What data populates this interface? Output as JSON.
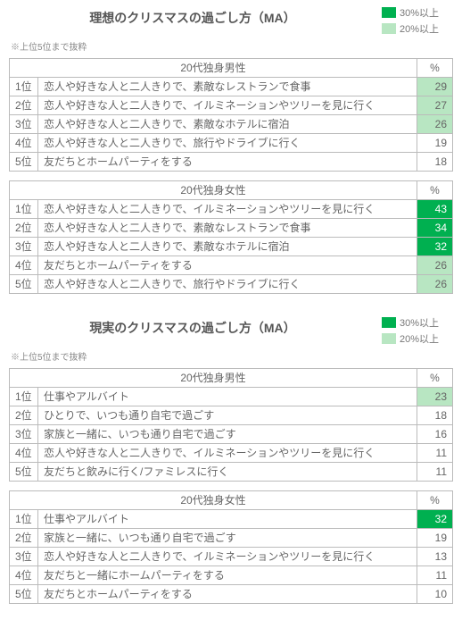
{
  "legend": {
    "high": "30%以上",
    "mid": "20%以上"
  },
  "note": "※上位5位まで抜粋",
  "col_pct": "%",
  "sections": [
    {
      "title": "理想のクリスマスの過ごし方（MA）",
      "tables": [
        {
          "header": "20代独身男性",
          "rows": [
            {
              "rank": "1位",
              "item": "恋人や好きな人と二人きりで、素敵なレストランで食事",
              "pct": 29,
              "shade": "light"
            },
            {
              "rank": "2位",
              "item": "恋人や好きな人と二人きりで、イルミネーションやツリーを見に行く",
              "pct": 27,
              "shade": "light"
            },
            {
              "rank": "3位",
              "item": "恋人や好きな人と二人きりで、素敵なホテルに宿泊",
              "pct": 26,
              "shade": "light"
            },
            {
              "rank": "4位",
              "item": "恋人や好きな人と二人きりで、旅行やドライブに行く",
              "pct": 19,
              "shade": ""
            },
            {
              "rank": "5位",
              "item": "友だちとホームパーティをする",
              "pct": 18,
              "shade": ""
            }
          ]
        },
        {
          "header": "20代独身女性",
          "rows": [
            {
              "rank": "1位",
              "item": "恋人や好きな人と二人きりで、イルミネーションやツリーを見に行く",
              "pct": 43,
              "shade": "dark"
            },
            {
              "rank": "2位",
              "item": "恋人や好きな人と二人きりで、素敵なレストランで食事",
              "pct": 34,
              "shade": "dark"
            },
            {
              "rank": "3位",
              "item": "恋人や好きな人と二人きりで、素敵なホテルに宿泊",
              "pct": 32,
              "shade": "dark"
            },
            {
              "rank": "4位",
              "item": "友だちとホームパーティをする",
              "pct": 26,
              "shade": "light"
            },
            {
              "rank": "5位",
              "item": "恋人や好きな人と二人きりで、旅行やドライブに行く",
              "pct": 26,
              "shade": "light"
            }
          ]
        }
      ]
    },
    {
      "title": "現実のクリスマスの過ごし方（MA）",
      "tables": [
        {
          "header": "20代独身男性",
          "rows": [
            {
              "rank": "1位",
              "item": "仕事やアルバイト",
              "pct": 23,
              "shade": "light"
            },
            {
              "rank": "2位",
              "item": "ひとりで、いつも通り自宅で過ごす",
              "pct": 18,
              "shade": ""
            },
            {
              "rank": "3位",
              "item": "家族と一緒に、いつも通り自宅で過ごす",
              "pct": 16,
              "shade": ""
            },
            {
              "rank": "4位",
              "item": "恋人や好きな人と二人きりで、イルミネーションやツリーを見に行く",
              "pct": 11,
              "shade": ""
            },
            {
              "rank": "5位",
              "item": "友だちと飲みに行く/ファミレスに行く",
              "pct": 11,
              "shade": ""
            }
          ]
        },
        {
          "header": "20代独身女性",
          "rows": [
            {
              "rank": "1位",
              "item": "仕事やアルバイト",
              "pct": 32,
              "shade": "dark"
            },
            {
              "rank": "2位",
              "item": "家族と一緒に、いつも通り自宅で過ごす",
              "pct": 19,
              "shade": ""
            },
            {
              "rank": "3位",
              "item": "恋人や好きな人と二人きりで、イルミネーションやツリーを見に行く",
              "pct": 13,
              "shade": ""
            },
            {
              "rank": "4位",
              "item": "友だちと一緒にホームパーティをする",
              "pct": 11,
              "shade": ""
            },
            {
              "rank": "5位",
              "item": "友だちとホームパーティをする",
              "pct": 10,
              "shade": ""
            }
          ]
        }
      ]
    }
  ],
  "chart_data": [
    {
      "type": "table",
      "title": "理想のクリスマスの過ごし方（MA） 20代独身男性",
      "categories": [
        "恋人や好きな人と二人きりで、素敵なレストランで食事",
        "恋人や好きな人と二人きりで、イルミネーションやツリーを見に行く",
        "恋人や好きな人と二人きりで、素敵なホテルに宿泊",
        "恋人や好きな人と二人きりで、旅行やドライブに行く",
        "友だちとホームパーティをする"
      ],
      "values": [
        29,
        27,
        26,
        19,
        18
      ],
      "ylabel": "%",
      "ylim": [
        0,
        100
      ]
    },
    {
      "type": "table",
      "title": "理想のクリスマスの過ごし方（MA） 20代独身女性",
      "categories": [
        "恋人や好きな人と二人きりで、イルミネーションやツリーを見に行く",
        "恋人や好きな人と二人きりで、素敵なレストランで食事",
        "恋人や好きな人と二人きりで、素敵なホテルに宿泊",
        "友だちとホームパーティをする",
        "恋人や好きな人と二人きりで、旅行やドライブに行く"
      ],
      "values": [
        43,
        34,
        32,
        26,
        26
      ],
      "ylabel": "%",
      "ylim": [
        0,
        100
      ]
    },
    {
      "type": "table",
      "title": "現実のクリスマスの過ごし方（MA） 20代独身男性",
      "categories": [
        "仕事やアルバイト",
        "ひとりで、いつも通り自宅で過ごす",
        "家族と一緒に、いつも通り自宅で過ごす",
        "恋人や好きな人と二人きりで、イルミネーションやツリーを見に行く",
        "友だちと飲みに行く/ファミレスに行く"
      ],
      "values": [
        23,
        18,
        16,
        11,
        11
      ],
      "ylabel": "%",
      "ylim": [
        0,
        100
      ]
    },
    {
      "type": "table",
      "title": "現実のクリスマスの過ごし方（MA） 20代独身女性",
      "categories": [
        "仕事やアルバイト",
        "家族と一緒に、いつも通り自宅で過ごす",
        "恋人や好きな人と二人きりで、イルミネーションやツリーを見に行く",
        "友だちと一緒にホームパーティをする",
        "友だちとホームパーティをする"
      ],
      "values": [
        32,
        19,
        13,
        11,
        10
      ],
      "ylabel": "%",
      "ylim": [
        0,
        100
      ]
    }
  ]
}
